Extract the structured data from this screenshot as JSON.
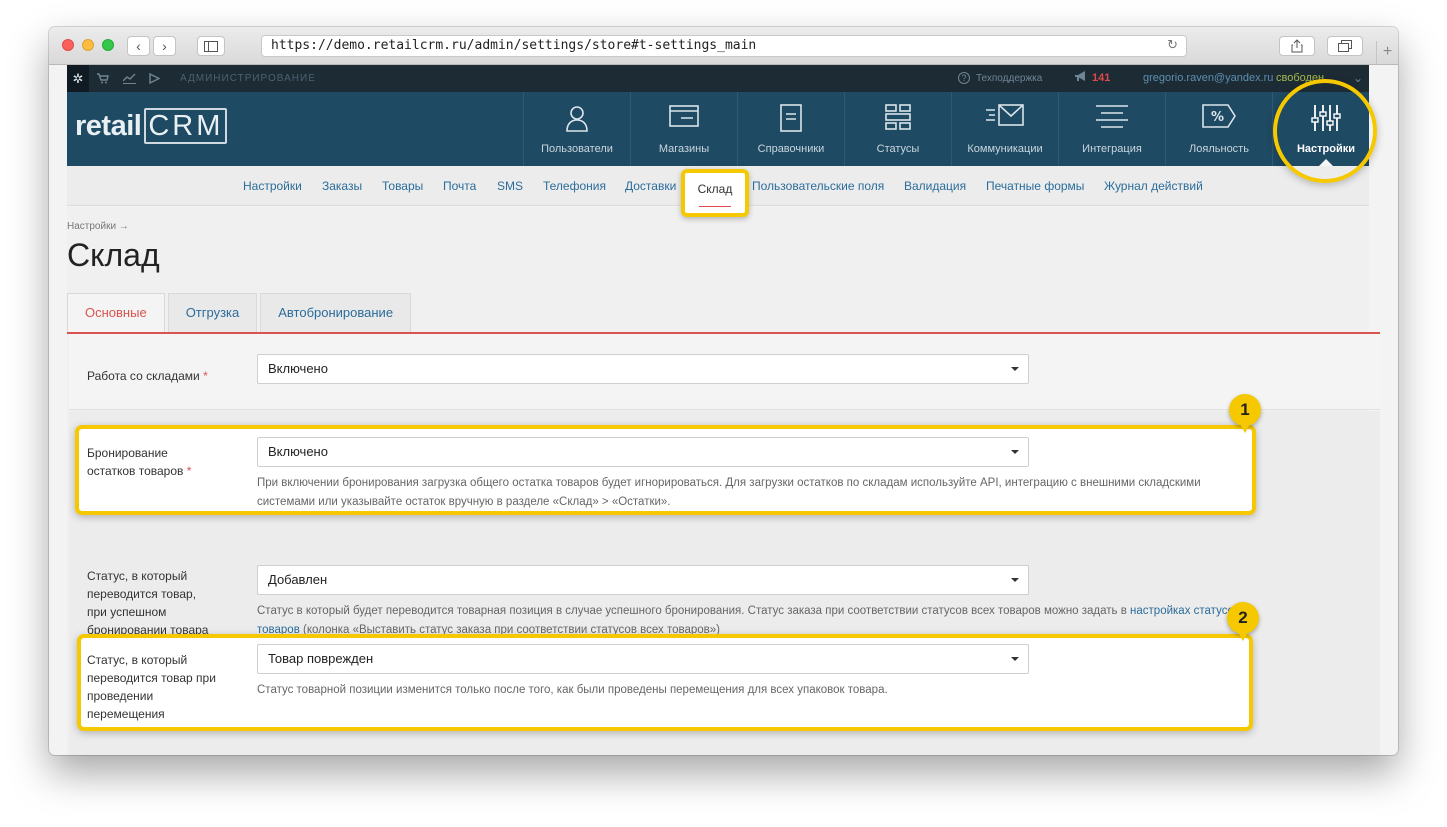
{
  "browser": {
    "url": "https://demo.retailcrm.ru/admin/settings/store#t-settings_main",
    "back": "‹",
    "forward": "›",
    "new_tab": "+"
  },
  "topbar": {
    "section": "АДМИНИСТРИРОВАНИЕ",
    "support": "Техподдержка",
    "notifications": "141",
    "user_email": "gregorio.raven@yandex.ru",
    "user_status": "свободен"
  },
  "header": {
    "logo_left": "retail",
    "logo_right": "CRM",
    "modules": [
      {
        "label": "Пользователи",
        "icon": "user-icon"
      },
      {
        "label": "Магазины",
        "icon": "store-icon"
      },
      {
        "label": "Справочники",
        "icon": "book-icon"
      },
      {
        "label": "Статусы",
        "icon": "statuses-icon"
      },
      {
        "label": "Коммуникации",
        "icon": "mail-icon"
      },
      {
        "label": "Интеграция",
        "icon": "integration-icon"
      },
      {
        "label": "Лояльность",
        "icon": "loyalty-icon"
      },
      {
        "label": "Настройки",
        "icon": "settings-sliders-icon"
      }
    ]
  },
  "subnav": {
    "items": [
      "Настройки",
      "Заказы",
      "Товары",
      "Почта",
      "SMS",
      "Телефония",
      "Доставки",
      "Склад",
      "Пользовательские поля",
      "Валидация",
      "Печатные формы",
      "Журнал действий"
    ],
    "active": "Склад"
  },
  "page": {
    "breadcrumb": "Настройки →",
    "title": "Склад",
    "tabs": [
      "Основные",
      "Отгрузка",
      "Автобронирование"
    ]
  },
  "form": {
    "warehouse_work": {
      "label": "Работа со складами",
      "value": "Включено"
    },
    "reservation": {
      "label_line1": "Бронирование",
      "label_line2": "остатков товаров",
      "value": "Включено",
      "help": "При включении бронирования загрузка общего остатка товаров будет игнорироваться. Для загрузки остатков по складам используйте API, интеграцию с внешними складскими системами или указывайте остаток вручную в разделе «Склад» > «Остатки»."
    },
    "reserve_status": {
      "label_lines": [
        "Статус, в который",
        "переводится товар,",
        "при успешном",
        "бронировании товара"
      ],
      "value": "Добавлен",
      "help_before": "Статус в который будет переводится товарная позиция в случае успешного бронирования. Статус заказа при соответствии статусов всех товаров можно задать в ",
      "help_link": "настройках статусов товаров",
      "help_after": " (колонка «Выставить статус заказа при соответствии статусов всех товаров»)"
    },
    "transfer_status": {
      "label_lines": [
        "Статус, в который",
        "переводится товар при",
        "проведении",
        "перемещения"
      ],
      "value": "Товар поврежден",
      "help": "Статус товарной позиции изменится только после того, как были проведены перемещения для всех упаковок товара."
    }
  },
  "callouts": {
    "first": "1",
    "second": "2"
  },
  "colors": {
    "accent": "#f6c800",
    "header_bg": "#1f4a63",
    "active_tab": "#d9534f",
    "link": "#2b6d9a"
  }
}
